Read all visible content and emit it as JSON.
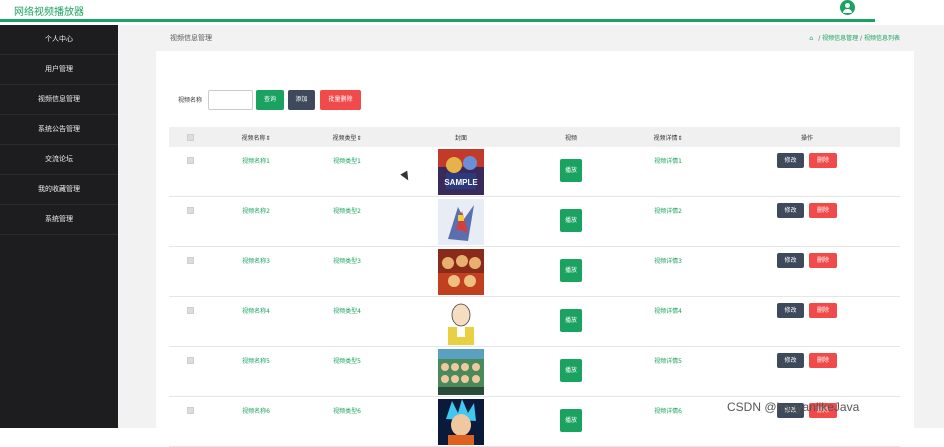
{
  "app": {
    "title": "网络视频播放器"
  },
  "sidebar": {
    "items": [
      {
        "label": "个人中心"
      },
      {
        "label": "用户管理"
      },
      {
        "label": "视频信息管理"
      },
      {
        "label": "系统公告管理"
      },
      {
        "label": "交流论坛"
      },
      {
        "label": "我的收藏管理"
      },
      {
        "label": "系统管理"
      }
    ]
  },
  "breadcrumb": {
    "page_title": "视频信息管理",
    "path_mid": "视频信息管理",
    "path_last": "视频信息列表",
    "sep": " / "
  },
  "search": {
    "label": "视频名称",
    "placeholder": "",
    "search_button": "查询",
    "add_button": "添加",
    "batch_delete_button": "批量删除"
  },
  "table": {
    "headers": {
      "name": "视频名称⇕",
      "type": "视频类型⇕",
      "cover": "封面",
      "video": "视频",
      "detail": "视频详情⇕",
      "actions": "操作"
    },
    "rows": [
      {
        "name": "视频名称1",
        "type": "视频类型1",
        "play": "播放",
        "detail": "视频详情1",
        "edit": "修改",
        "delete": "删除"
      },
      {
        "name": "视频名称2",
        "type": "视频类型2",
        "play": "播放",
        "detail": "视频详情2",
        "edit": "修改",
        "delete": "删除"
      },
      {
        "name": "视频名称3",
        "type": "视频类型3",
        "play": "播放",
        "detail": "视频详情3",
        "edit": "修改",
        "delete": "删除"
      },
      {
        "name": "视频名称4",
        "type": "视频类型4",
        "play": "播放",
        "detail": "视频详情4",
        "edit": "修改",
        "delete": "删除"
      },
      {
        "name": "视频名称5",
        "type": "视频类型5",
        "play": "播放",
        "detail": "视频详情5",
        "edit": "修改",
        "delete": "删除"
      },
      {
        "name": "视频名称6",
        "type": "视频类型6",
        "play": "播放",
        "detail": "视频详情6",
        "edit": "修改",
        "delete": "删除"
      }
    ]
  },
  "covers": {
    "first_overlay": "SAMPLE"
  },
  "watermark": {
    "text": "CSDN @haoyanlikeJava"
  },
  "colors": {
    "accent": "#1aa260",
    "danger": "#f14a4a",
    "dark_button": "#3e4a5c",
    "sidebar_bg": "#1d1d1f"
  }
}
